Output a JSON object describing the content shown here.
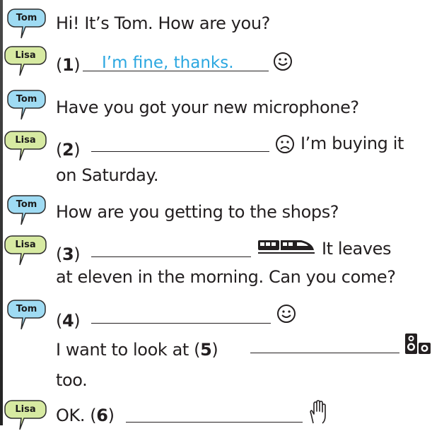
{
  "speakers": {
    "tom": "Tom",
    "lisa": "Lisa"
  },
  "colors": {
    "tom_bubble": "#9fdbf3",
    "lisa_bubble": "#d7eaa2",
    "answer": "#2ba7e0",
    "text": "#231f20"
  },
  "lines": {
    "l1": "Hi! It’s Tom. How are you?",
    "l2_num": "1",
    "l2_answer": "I’m fine, thanks.",
    "l3": "Have you got your new microphone?",
    "l4_num": "2",
    "l4_after": "I’m buying it",
    "l5": "on Saturday.",
    "l6": "How are you getting to the shops?",
    "l7_num": "3",
    "l7_after": "It leaves",
    "l8": "at eleven in the morning. Can you come?",
    "l9_num": "4",
    "l10_before": "I want to look at",
    "l10_num": "5",
    "l11": "too.",
    "l12_ok": "OK.",
    "l12_num": "6"
  },
  "icons": {
    "smile_1": "smiley-face-icon",
    "sad_2": "sad-face-icon",
    "train_3": "train-icon",
    "smile_4": "smiley-face-icon",
    "speakers_5": "speaker-icon",
    "hand_6": "raised-hand-icon"
  }
}
